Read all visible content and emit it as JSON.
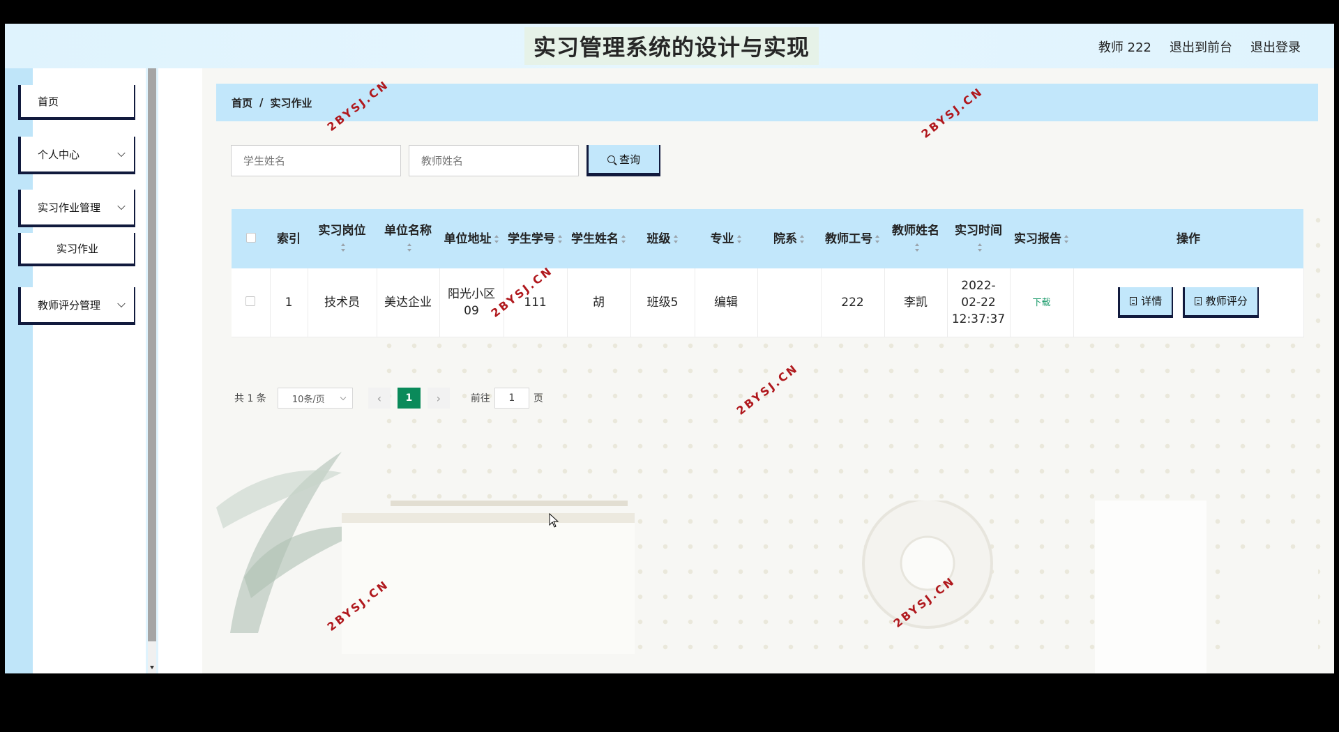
{
  "header": {
    "title": "实习管理系统的设计与实现",
    "user": "教师 222",
    "back_to_front": "退出到前台",
    "logout": "退出登录"
  },
  "sidebar": {
    "items": [
      {
        "label": "首页",
        "icon": "none"
      },
      {
        "label": "个人中心",
        "icon": "chevron-down-icon"
      },
      {
        "label": "实习作业管理",
        "icon": "chevron-down-icon"
      },
      {
        "label": "实习作业",
        "icon": "none"
      },
      {
        "label": "教师评分管理",
        "icon": "chevron-down-icon"
      }
    ]
  },
  "breadcrumb": {
    "home": "首页",
    "separator": "/",
    "current": "实习作业"
  },
  "search": {
    "student_placeholder": "学生姓名",
    "teacher_placeholder": "教师姓名",
    "button_label": "查询",
    "button_icon": "search-icon"
  },
  "table": {
    "headers": [
      "索引",
      "实习岗位",
      "单位名称",
      "单位地址",
      "学生学号",
      "学生姓名",
      "班级",
      "专业",
      "院系",
      "教师工号",
      "教师姓名",
      "实习时间",
      "实习报告",
      "操作"
    ],
    "rows": [
      {
        "index": "1",
        "position": "技术员",
        "company": "美达企业",
        "address": "阳光小区09",
        "student_id": "111",
        "student_name": "胡",
        "class": "班级5",
        "major": "编辑",
        "dept": "",
        "teacher_id": "222",
        "teacher_name": "李凯",
        "time": "2022-02-22 12:37:37",
        "report": "下载",
        "detail_label": "详情",
        "score_label": "教师评分"
      }
    ]
  },
  "pagination": {
    "total": "共 1 条",
    "page_size": "10条/页",
    "current_page": "1",
    "goto_prefix": "前往",
    "goto_value": "1",
    "goto_suffix": "页"
  },
  "watermark": "2BYSJ.CN",
  "colors": {
    "accent": "#c2e7fb",
    "border_dark": "#111a3d",
    "pager_active": "#0a8a5a",
    "download_link": "#1a9a6a"
  }
}
